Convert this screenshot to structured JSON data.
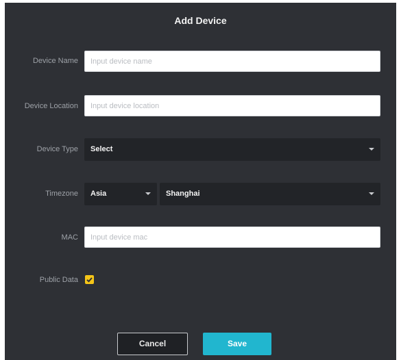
{
  "dialog": {
    "title": "Add Device"
  },
  "form": {
    "device_name": {
      "label": "Device Name",
      "placeholder": "Input device name",
      "value": ""
    },
    "device_location": {
      "label": "Device Location",
      "placeholder": "Input device location",
      "value": ""
    },
    "device_type": {
      "label": "Device Type",
      "selected": "Select"
    },
    "timezone": {
      "label": "Timezone",
      "region": "Asia",
      "city": "Shanghai"
    },
    "mac": {
      "label": "MAC",
      "placeholder": "Input device mac",
      "value": ""
    },
    "public_data": {
      "label": "Public Data",
      "checked": true
    }
  },
  "buttons": {
    "cancel_label": "Cancel",
    "save_label": "Save"
  },
  "colors": {
    "dialog_bg": "#2e3035",
    "select_bg": "#222428",
    "accent": "#21b6cf",
    "checkbox": "#f5c518"
  }
}
